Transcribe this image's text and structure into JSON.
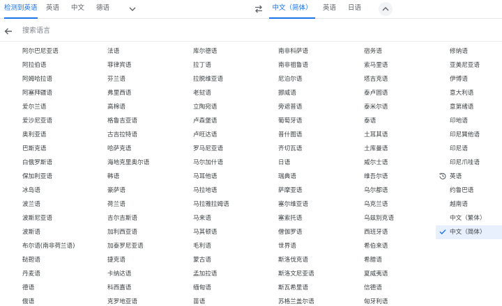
{
  "source_tabs": [
    "检测到英语",
    "英语",
    "中文",
    "德语"
  ],
  "target_tabs": [
    "中文（简体）",
    "英语",
    "日语"
  ],
  "search": {
    "placeholder": "搜索语言"
  },
  "colors": {
    "accent": "#1a73e8",
    "selected_bg": "#e8f0fe"
  },
  "icons": {
    "source_expand": "chevron-down-icon",
    "swap": "swap-icon",
    "target_collapse": "chevron-up-icon",
    "back": "arrow-back-icon",
    "recent": "history-icon",
    "selected": "check-icon"
  },
  "columns": [
    [
      "阿尔巴尼亚语",
      "阿拉伯语",
      "阿姆哈拉语",
      "阿塞拜疆语",
      "爱尔兰语",
      "爱沙尼亚语",
      "奥利亚语",
      "巴斯克语",
      "白俄罗斯语",
      "保加利亚语",
      "冰岛语",
      "波兰语",
      "波斯尼亚语",
      "波斯语",
      "布尔语(南非荷兰语)",
      "鞑靼语",
      "丹麦语",
      "德语",
      "俄语"
    ],
    [
      "法语",
      "菲律宾语",
      "芬兰语",
      "弗里西语",
      "高棉语",
      "格鲁吉亚语",
      "古吉拉特语",
      "哈萨克语",
      "海地克里奥尔语",
      "韩语",
      "豪萨语",
      "荷兰语",
      "吉尔吉斯语",
      "加利西亚语",
      "加泰罗尼亚语",
      "捷克语",
      "卡纳达语",
      "科西嘉语",
      "克罗地亚语"
    ],
    [
      "库尔德语",
      "拉丁语",
      "拉脱维亚语",
      "老挝语",
      "立陶宛语",
      "卢森堡语",
      "卢旺达语",
      "罗马尼亚语",
      "马尔加什语",
      "马耳他语",
      "马拉地语",
      "马拉雅拉姆语",
      "马来语",
      "马其顿语",
      "毛利语",
      "蒙古语",
      "孟加拉语",
      "缅甸语",
      "苗语"
    ],
    [
      "南非科萨语",
      "南非祖鲁语",
      "尼泊尔语",
      "挪威语",
      "旁遮普语",
      "葡萄牙语",
      "普什图语",
      "齐切瓦语",
      "日语",
      "瑞典语",
      "萨摩亚语",
      "塞尔维亚语",
      "塞索托语",
      "僧伽罗语",
      "世界语",
      "斯洛伐克语",
      "斯洛文尼亚语",
      "斯瓦希里语",
      "苏格兰盖尔语"
    ],
    [
      "宿务语",
      "索马里语",
      "塔吉克语",
      "泰卢固语",
      "泰米尔语",
      "泰语",
      "土耳其语",
      "土库曼语",
      "威尔士语",
      "维吾尔语",
      "乌尔都语",
      "乌克兰语",
      "乌兹别克语",
      "西班牙语",
      "希伯来语",
      "希腊语",
      "夏威夷语",
      "信德语",
      "匈牙利语"
    ],
    [
      "修纳语",
      "亚美尼亚语",
      "伊博语",
      "意大利语",
      "意第绪语",
      "印地语",
      "印尼巽他语",
      "印尼语",
      "印尼爪哇语",
      "英语",
      "约鲁巴语",
      "越南语",
      "中文（繁体）",
      "中文（简体）"
    ]
  ],
  "recent_item": "英语",
  "selected_item": "中文（简体）"
}
